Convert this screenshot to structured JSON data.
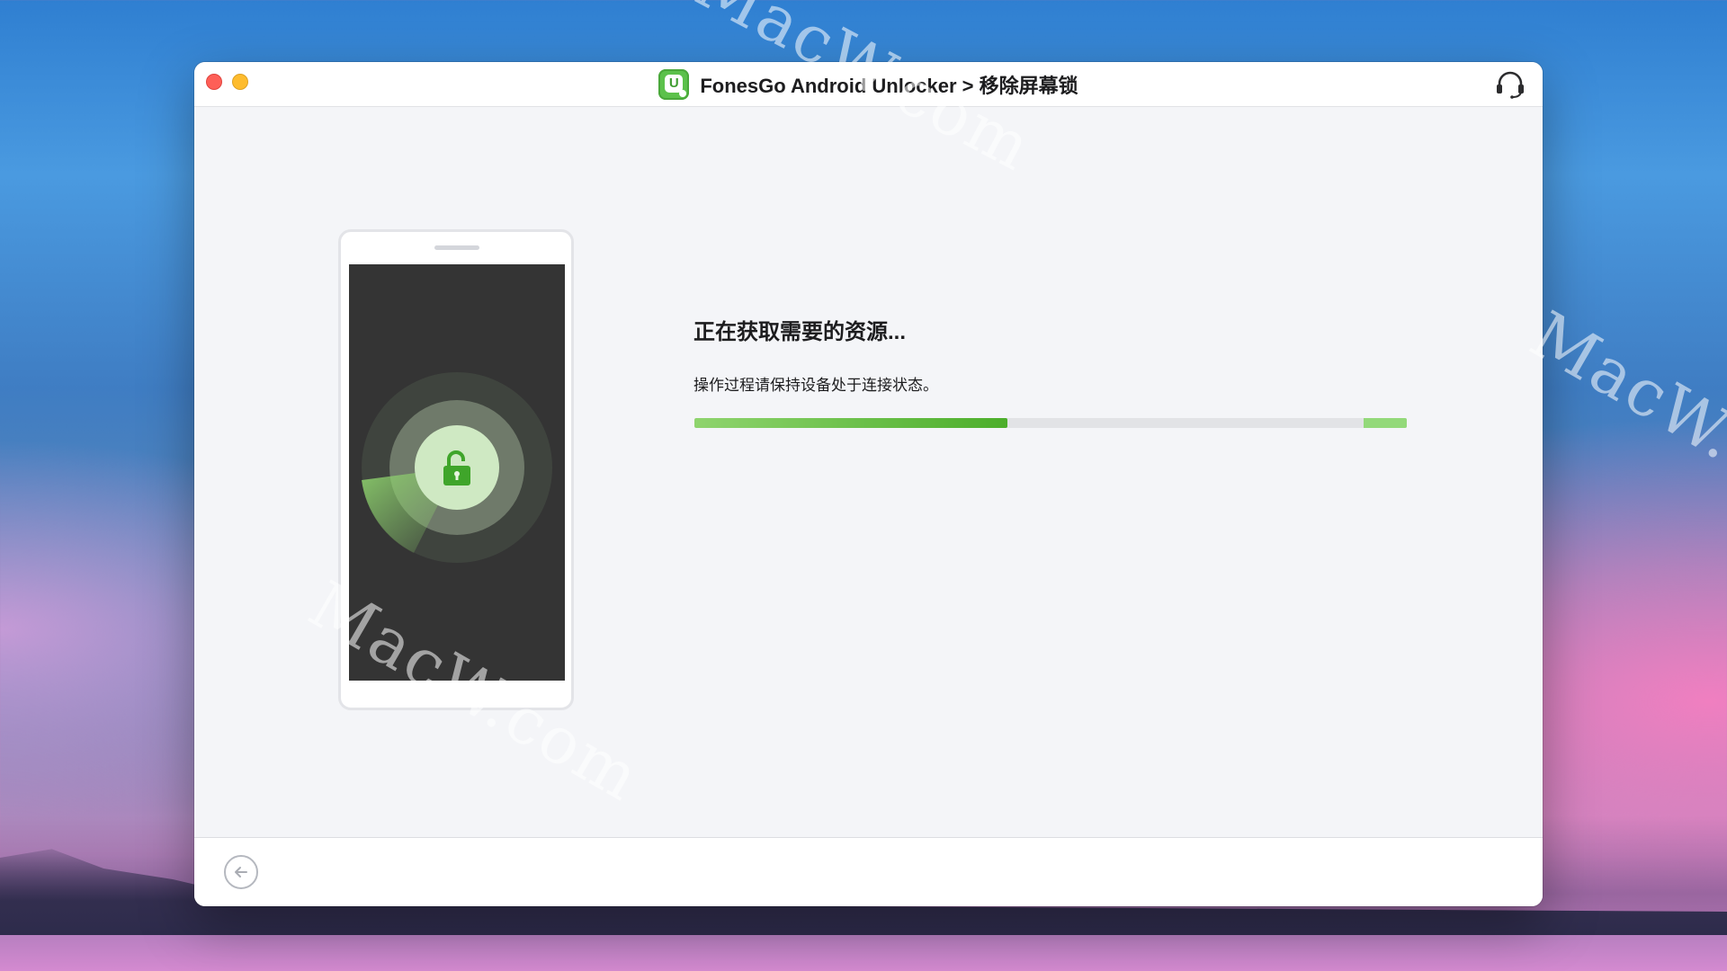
{
  "window": {
    "title": "FonesGo Android Unlocker",
    "breadcrumb_separator": ">",
    "breadcrumb_current": "移除屏幕锁",
    "app_icon_letter": "U"
  },
  "status": {
    "title": "正在获取需要的资源...",
    "subtitle": "操作过程请保持设备处于连接状态。",
    "progress": 0.44
  },
  "watermarks": [
    "MacW.com",
    "MacW.com",
    "MacW.com"
  ],
  "icons": {
    "support": "headset-icon",
    "back": "arrow-left-icon",
    "lock": "unlock-icon"
  },
  "colors": {
    "accent": "#4cae2b",
    "accent_light": "#93d97a",
    "close": "#fe5f57",
    "minimize": "#febc2e"
  }
}
